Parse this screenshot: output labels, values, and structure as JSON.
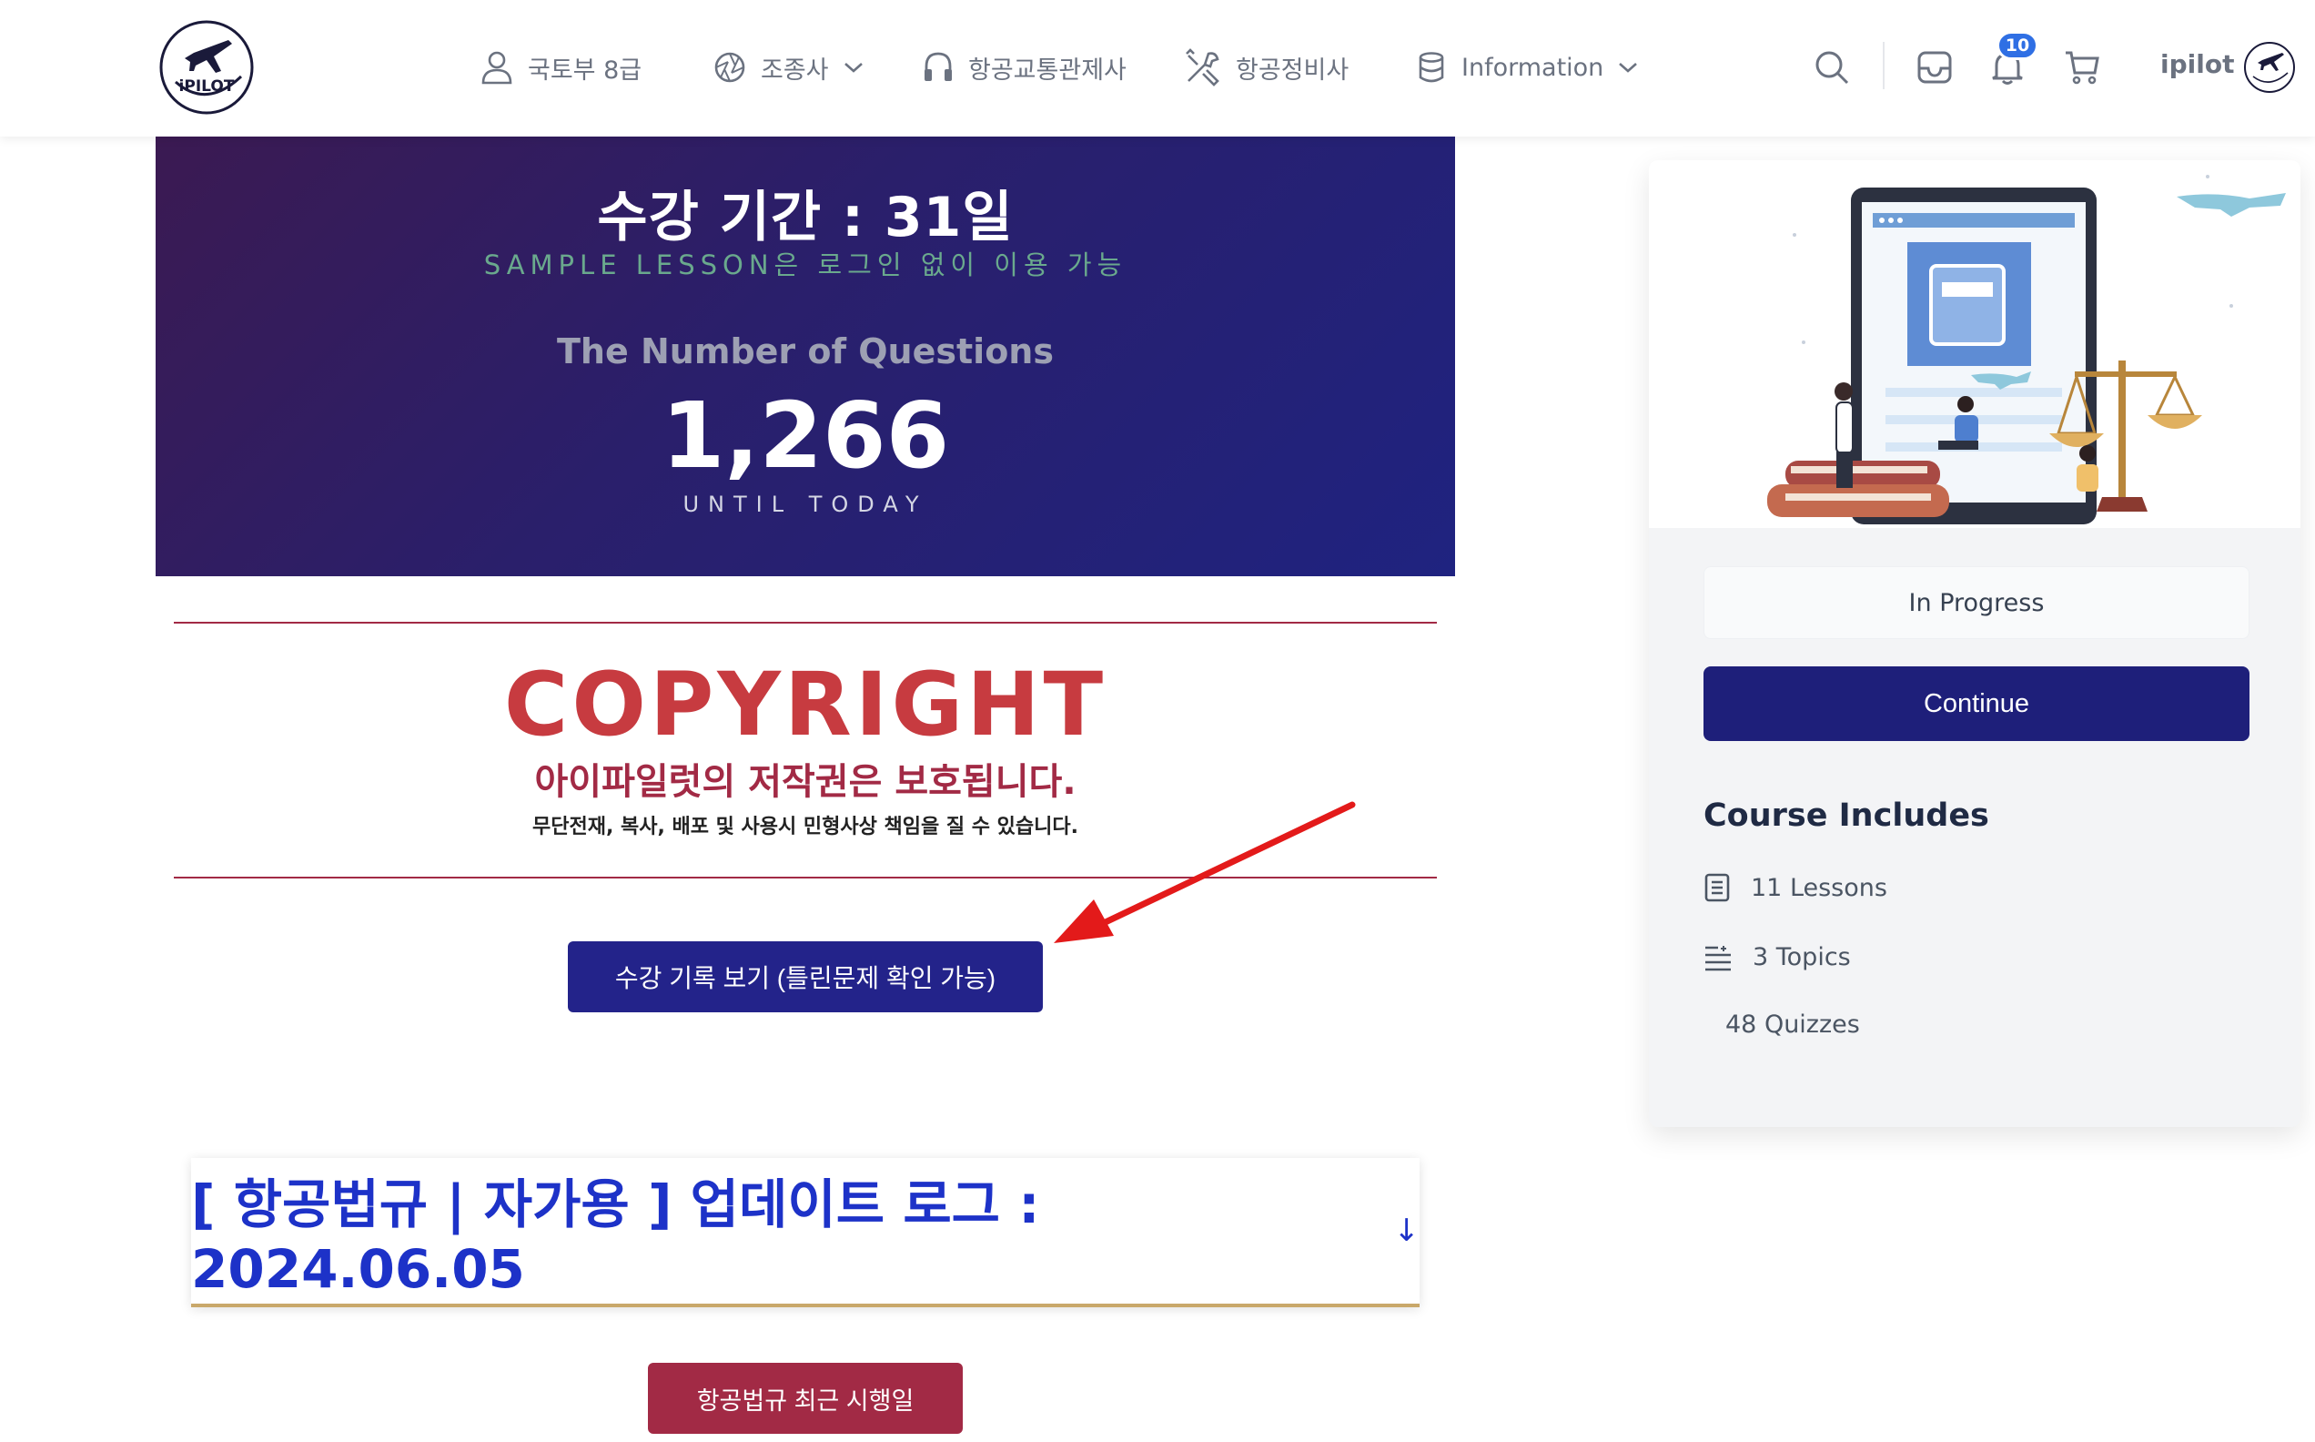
{
  "header": {
    "logo_text": "iPILOT",
    "nav": [
      {
        "label": "국토부 8급",
        "icon": "user-icon"
      },
      {
        "label": "조종사",
        "icon": "aperture-icon",
        "has_dropdown": true
      },
      {
        "label": "항공교통관제사",
        "icon": "headphones-icon"
      },
      {
        "label": "항공정비사",
        "icon": "tools-icon"
      },
      {
        "label": "Information",
        "icon": "database-icon",
        "has_dropdown": true
      }
    ],
    "notification_count": "10",
    "username": "ipilot"
  },
  "hero": {
    "period": "수강 기간 : 31일",
    "sample_note": "SAMPLE LESSON은 로그인 없이 이용 가능",
    "questions_label": "The Number of Questions",
    "questions_count": "1,266",
    "until": "UNTIL TODAY"
  },
  "copyright": {
    "title": "COPYRIGHT",
    "subtitle": "아이파일럿의 저작권은 보호됩니다.",
    "note": "무단전재, 복사, 배포 및 사용시 민형사상 책임을 질 수 있습니다."
  },
  "history_button": "수강 기록 보기 (틀린문제 확인 가능)",
  "update_log": {
    "title": "[ 항공법규 | 자가용 ] 업데이트 로그 : 2024.06.05",
    "arrow": "↓"
  },
  "date_button": "항공법규 최근 시행일",
  "sidebar": {
    "status": "In Progress",
    "continue": "Continue",
    "includes_title": "Course Includes",
    "items": [
      {
        "label": "11 Lessons",
        "icon": "document-icon"
      },
      {
        "label": "3 Topics",
        "icon": "list-icon"
      },
      {
        "label": "48 Quizzes",
        "icon": ""
      }
    ]
  },
  "colors": {
    "brand_navy": "#1e1f7a",
    "copyright_red": "#c73b40",
    "maroon": "#a22a45",
    "log_blue": "#1d32c8",
    "notif_blue": "#2f6fe4"
  }
}
